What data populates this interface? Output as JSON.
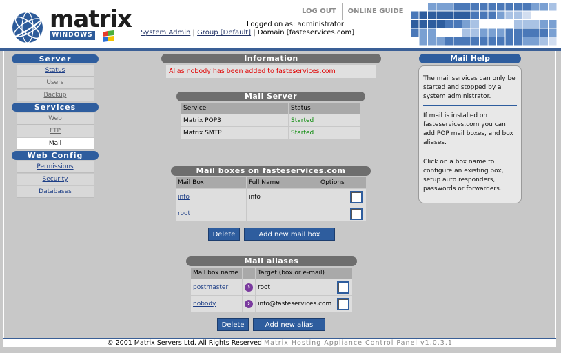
{
  "header": {
    "logo_word": "matrix",
    "logo_sub": "WINDOWS",
    "nav": {
      "logout": "LOG OUT",
      "guide": "ONLINE GUIDE"
    },
    "logged_as": "Logged on as: administrator",
    "crumbs": {
      "admin": "System Admin",
      "sep1": "|",
      "group": "Group [Default]",
      "sep2": "|",
      "domain": "Domain [fasteservices.com]"
    }
  },
  "sidebar": {
    "server": {
      "title": "Server",
      "items": [
        "Status",
        "Users",
        "Backup"
      ]
    },
    "services": {
      "title": "Services",
      "items": [
        "Web",
        "FTP",
        "Mail"
      ]
    },
    "webconfig": {
      "title": "Web Config",
      "items": [
        "Permissions",
        "Security",
        "Databases"
      ]
    }
  },
  "information": {
    "title": "Information",
    "message": "Alias nobody has been added to fasteservices.com"
  },
  "mail_server": {
    "title": "Mail Server",
    "columns": [
      "Service",
      "Status"
    ],
    "rows": [
      {
        "service": "Matrix POP3",
        "status": "Started"
      },
      {
        "service": "Matrix SMTP",
        "status": "Started"
      }
    ]
  },
  "mailboxes": {
    "title": "Mail boxes on fasteservices.com",
    "columns": [
      "Mail Box",
      "Full Name",
      "Options"
    ],
    "rows": [
      {
        "box": "info",
        "full_name": "info"
      },
      {
        "box": "root",
        "full_name": ""
      }
    ],
    "delete_label": "Delete",
    "add_label": "Add new mail box"
  },
  "aliases": {
    "title": "Mail aliases",
    "columns": [
      "Mail box name",
      "Target (box or e-mail)"
    ],
    "rows": [
      {
        "name": "postmaster",
        "target": "root"
      },
      {
        "name": "nobody",
        "target": "info@fasteservices.com"
      }
    ],
    "delete_label": "Delete",
    "add_label": "Add new alias"
  },
  "help": {
    "title": "Mail Help",
    "p1": "The mail services can only be started and stopped by a system administrator.",
    "p2": "If mail is installed on fasteservices.com you can add POP mail boxes, and box aliases.",
    "p3": "Click on a box name to configure an existing box, setup auto responders, passwords or forwarders."
  },
  "footer": {
    "copyright": "© 2001 Matrix Servers Ltd. All Rights Reserved",
    "version": "Matrix Hosting Appliance Control Panel v1.0.3.1"
  },
  "colors": {
    "accent": "#2e5d9e",
    "section_grey": "#6e6e6e",
    "started": "#0a8a0a",
    "alert": "#e00000"
  }
}
